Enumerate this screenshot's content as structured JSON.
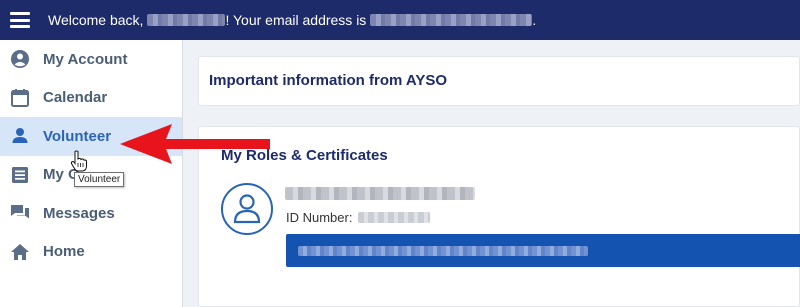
{
  "topbar": {
    "welcome_prefix": "Welcome back,",
    "email_prefix": "! Your email address is",
    "email_suffix": ".",
    "bg_color": "#1d2b6b"
  },
  "sidebar": {
    "items": [
      {
        "label": "My Account",
        "icon": "account-circle-icon"
      },
      {
        "label": "Calendar",
        "icon": "calendar-icon"
      },
      {
        "label": "Volunteer",
        "icon": "person-icon",
        "active": true
      },
      {
        "label": "My O",
        "icon": "list-icon"
      },
      {
        "label": "Messages",
        "icon": "messages-icon"
      },
      {
        "label": "Home",
        "icon": "home-icon"
      }
    ]
  },
  "tooltip": {
    "text": "Volunteer"
  },
  "main": {
    "info_title": "Important information from AYSO",
    "roles_title": "My Roles & Certificates",
    "id_label": "ID Number:"
  },
  "annotation": {
    "arrow_color": "#e8141c",
    "arrow_target": "Volunteer"
  }
}
